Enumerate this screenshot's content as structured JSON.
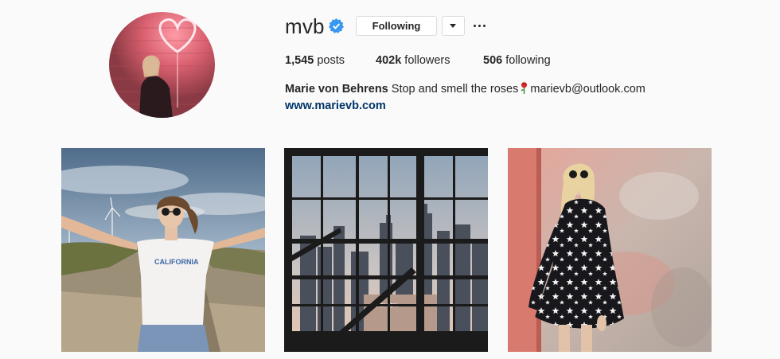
{
  "profile": {
    "username": "mvb",
    "verified": true,
    "verified_icon": "verified-badge-icon",
    "follow_button_label": "Following",
    "dropdown_icon": "caret-down-icon",
    "more_icon": "more-options-icon",
    "avatar_description": "profile photo"
  },
  "stats": {
    "posts_count": "1,545",
    "posts_label": " posts",
    "followers_count": "402k",
    "followers_label": " followers",
    "following_count": "506",
    "following_label": " following"
  },
  "bio": {
    "full_name": "Marie von Behrens",
    "text_before_emoji": " Stop and smell the roses",
    "emoji_icon": "rose-emoji-icon",
    "text_after_emoji": "marievb@outlook.com",
    "website": "www.marievb.com"
  },
  "posts": [
    {
      "icon": "post-photo-desert-windmills"
    },
    {
      "icon": "post-photo-city-window"
    },
    {
      "icon": "post-photo-star-dress"
    }
  ],
  "colors": {
    "text": "#262626",
    "link": "#003569",
    "verified_blue": "#3897f0",
    "border": "#dbdbdb",
    "background": "#fafafa"
  }
}
